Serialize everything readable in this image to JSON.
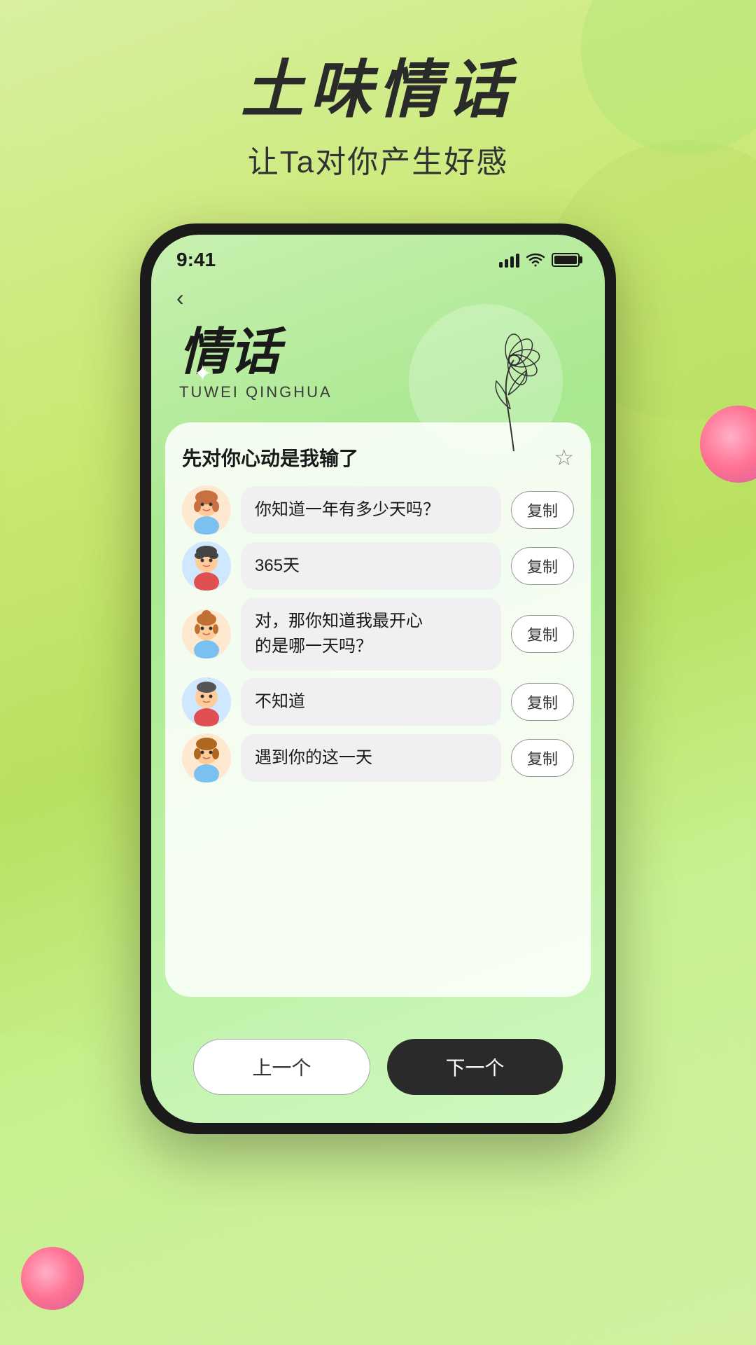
{
  "page": {
    "main_title": "土味情话",
    "sub_title": "让Ta对你产生好感",
    "status_time": "9:41",
    "back_label": "‹",
    "app_title_cn": "情话",
    "app_title_en": "TUWEI QINGHUA",
    "sparkle": "✦",
    "card_title": "先对你心动是我输了",
    "star_icon": "☆",
    "dialogs": [
      {
        "id": 1,
        "gender": "girl",
        "text": "你知道一年有多少天吗？",
        "copy_label": "复制"
      },
      {
        "id": 2,
        "gender": "boy",
        "text": "365天",
        "copy_label": "复制"
      },
      {
        "id": 3,
        "gender": "girl",
        "text": "对，那你知道我最开心的是哪一天吗？",
        "copy_label": "复制"
      },
      {
        "id": 4,
        "gender": "boy",
        "text": "不知道",
        "copy_label": "复制"
      },
      {
        "id": 5,
        "gender": "girl",
        "text": "遇到你的这一天",
        "copy_label": "复制"
      }
    ],
    "btn_prev": "上一个",
    "btn_next": "下一个"
  }
}
